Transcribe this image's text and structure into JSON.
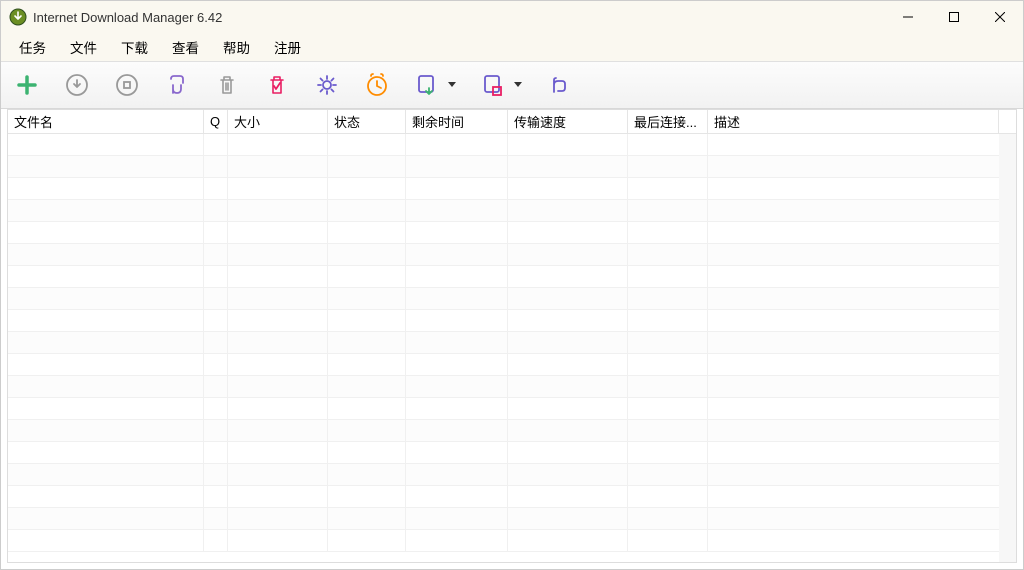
{
  "window": {
    "title": "Internet Download Manager 6.42"
  },
  "menu": {
    "tasks": "任务",
    "file": "文件",
    "downloads": "下载",
    "view": "查看",
    "help": "帮助",
    "register": "注册"
  },
  "columns": {
    "filename": "文件名",
    "q": "Q",
    "size": "大小",
    "status": "状态",
    "timeleft": "剩余时间",
    "speed": "传输速度",
    "lastconn": "最后连接...",
    "description": "描述"
  }
}
